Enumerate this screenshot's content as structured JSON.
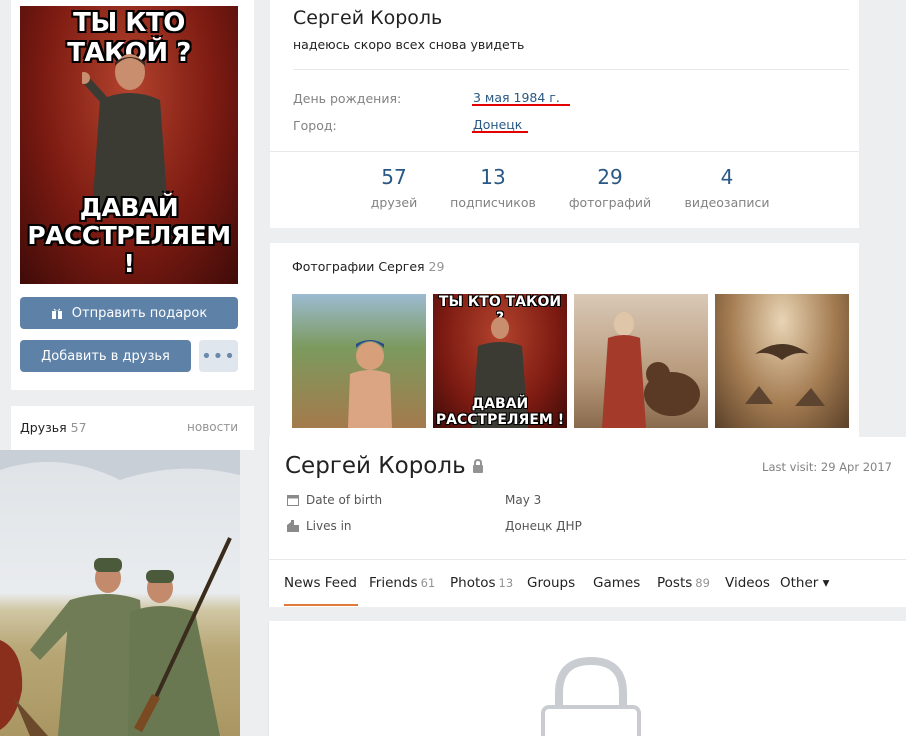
{
  "top_profile": {
    "avatar_meme": {
      "top_text": "ТЫ КТО ТАКОЙ ?",
      "bottom_text_1": "ДАВАЙ",
      "bottom_text_2": "РАССТРЕЛЯЕМ !"
    },
    "buttons": {
      "gift_label": "Отправить подарок",
      "add_friend_label": "Добавить в друзья",
      "more_label": "•••"
    },
    "friends_block": {
      "title": "Друзья",
      "count": "57",
      "news_link": "новости"
    },
    "name": "Сергей Король",
    "status": "надеюсь скоро всех снова увидеть",
    "info": {
      "birthday_label": "День рождения:",
      "birthday_value": "3 мая 1984 г.",
      "city_label": "Город:",
      "city_value": "Донецк"
    },
    "counters": [
      {
        "num": "57",
        "label": "друзей"
      },
      {
        "num": "13",
        "label": "подписчиков"
      },
      {
        "num": "29",
        "label": "фотографий"
      },
      {
        "num": "4",
        "label": "видеозаписи"
      }
    ],
    "photos": {
      "title": "Фотографии Сергея",
      "count": "29",
      "thumb2_top": "ТЫ КТО ТАКОЙ ?",
      "thumb2_bottom_1": "ДАВАЙ",
      "thumb2_bottom_2": "РАССТРЕЛЯЕМ !"
    }
  },
  "bottom_profile": {
    "name": "Сергей Король",
    "last_visit": "Last visit: 29 Apr 2017",
    "rows": {
      "dob_label": "Date of birth",
      "dob_value": "May 3",
      "lives_label": "Lives in",
      "lives_value": "Донецк ДНР"
    },
    "tabs": [
      {
        "label": "News Feed",
        "count": ""
      },
      {
        "label": "Friends",
        "count": "61"
      },
      {
        "label": "Photos",
        "count": "13"
      },
      {
        "label": "Groups",
        "count": ""
      },
      {
        "label": "Games",
        "count": ""
      },
      {
        "label": "Posts",
        "count": "89"
      },
      {
        "label": "Videos",
        "count": ""
      },
      {
        "label": "Other ▾",
        "count": ""
      }
    ],
    "active_tab": "News Feed"
  },
  "colors": {
    "link": "#2a5885",
    "button": "#5e81a8",
    "highlight_underline": "#e30000",
    "active_tab": "#e07b39"
  }
}
